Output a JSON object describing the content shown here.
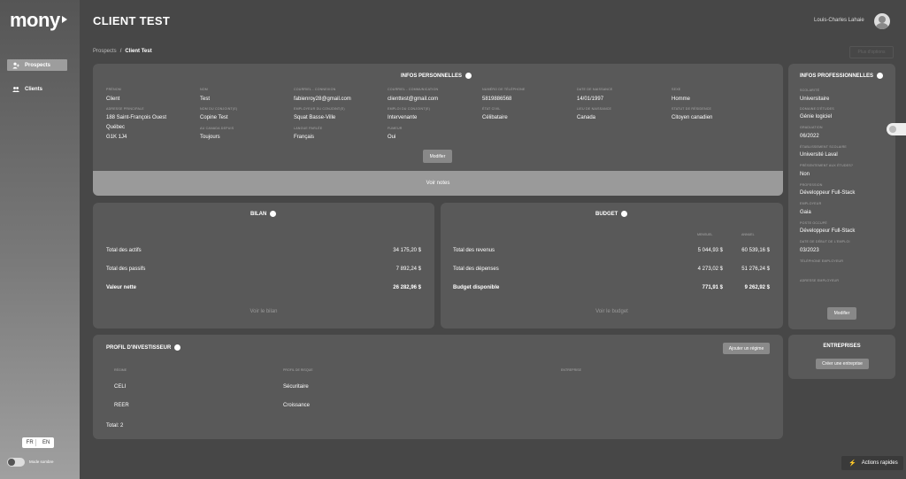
{
  "app": {
    "logo": "mony"
  },
  "sidebar": {
    "items": [
      {
        "label": "Prospects",
        "active": true
      },
      {
        "label": "Clients",
        "active": false
      }
    ],
    "lang": [
      "FR",
      "EN"
    ],
    "dark_mode_label": "Mode sombre"
  },
  "header": {
    "title": "CLIENT TEST",
    "user": "Louis-Charles Lahaie",
    "breadcrumb": [
      "Prospects",
      "Client Test"
    ],
    "action_ghost": "Plus d'options"
  },
  "personal": {
    "title": "INFOS PERSONNELLES",
    "fields": [
      {
        "label": "Prénom",
        "value": "Client"
      },
      {
        "label": "Nom",
        "value": "Test"
      },
      {
        "label": "Courriel - connexion",
        "value": "fabienroy28@gmail.com"
      },
      {
        "label": "Courriel - communication",
        "value": "clienttest@gmail.com"
      },
      {
        "label": "Numéro de téléphone",
        "value": "5819886568"
      },
      {
        "label": "Date de naissance",
        "value": "14/01/1997"
      },
      {
        "label": "Sexe",
        "value": "Homme"
      },
      {
        "label": "Adresse principale",
        "value": "188 Saint-François Ouest"
      },
      {
        "label": "Nom du conjoint(e)",
        "value": "Copine Test"
      },
      {
        "label": "Employeur du conjoint(e)",
        "value": "Squat Basse-Ville"
      },
      {
        "label": "Emploi du conjoint(e)",
        "value": "Intervenante"
      },
      {
        "label": "État civil",
        "value": "Célibataire"
      },
      {
        "label": "Lieu de naissance",
        "value": "Canada"
      },
      {
        "label": "Statut de résidence",
        "value": "Citoyen canadien"
      },
      {
        "label": "Au Canada depuis",
        "value": "Toujours"
      },
      {
        "label": "Langue parlée",
        "value": "Français"
      },
      {
        "label": "Fumeur",
        "value": "Oui"
      }
    ],
    "address_line2": "Québec",
    "address_line3": "G1K 1J4",
    "edit_button": "Modifier",
    "notes": "Voir notes"
  },
  "bilan": {
    "title": "BILAN",
    "rows": [
      {
        "label": "Total des actifs",
        "value": "34 175,20 $"
      },
      {
        "label": "Total des passifs",
        "value": "7 892,24 $"
      },
      {
        "label": "Valeur nette",
        "value": "26 282,96 $"
      }
    ],
    "link": "Voir le bilan"
  },
  "budget": {
    "title": "BUDGET",
    "col_monthly": "Mensuel",
    "col_annual": "Annuel",
    "rows": [
      {
        "label": "Total des revenus",
        "monthly": "5 044,93 $",
        "annual": "60 539,16 $"
      },
      {
        "label": "Total des dépenses",
        "monthly": "4 273,02 $",
        "annual": "51 276,24 $"
      },
      {
        "label": "Budget disponible",
        "monthly": "771,91 $",
        "annual": "9 262,92 $"
      }
    ],
    "link": "Voir le budget"
  },
  "investor": {
    "title": "PROFIL D'INVESTISSEUR",
    "add_button": "Ajouter un régime",
    "headers": [
      "Régime",
      "Profil de risque",
      "Entreprise"
    ],
    "rows": [
      {
        "regime": "CELI",
        "risk": "Sécuritaire"
      },
      {
        "regime": "REER",
        "risk": "Croissance"
      }
    ],
    "total": "Total: 2"
  },
  "professional": {
    "title": "INFOS PROFESSIONNELLES",
    "fields": [
      {
        "label": "Scolarité",
        "value": "Universitaire"
      },
      {
        "label": "Domaine d'études",
        "value": "Génie logiciel"
      },
      {
        "label": "Graduation",
        "value": "06/2022"
      },
      {
        "label": "Établissement scolaire",
        "value": "Université Laval"
      },
      {
        "label": "Présentement aux études?",
        "value": "Non"
      },
      {
        "label": "Profession",
        "value": "Développeur Full-Stack"
      },
      {
        "label": "Employeur",
        "value": "Gaia"
      },
      {
        "label": "Poste occupé",
        "value": "Développeur Full-Stack"
      },
      {
        "label": "Date de début de l'emploi",
        "value": "03/2023"
      },
      {
        "label": "Téléphone employeur",
        "value": ""
      },
      {
        "label": "Adresse employeur",
        "value": ""
      }
    ],
    "edit_button": "Modifier"
  },
  "companies": {
    "title": "ENTREPRISES",
    "button": "Créer une entreprise"
  },
  "quick_actions": "Actions rapides"
}
